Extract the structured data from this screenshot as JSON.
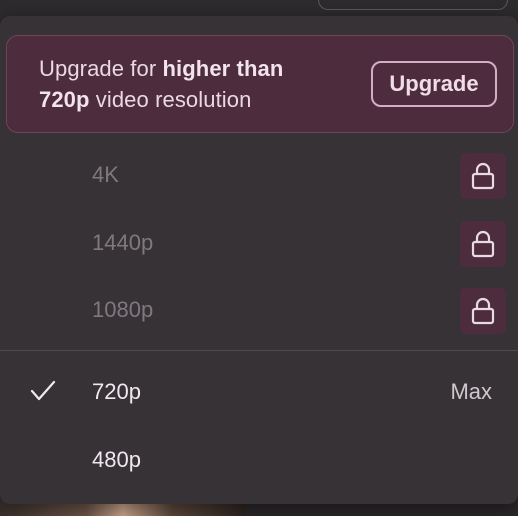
{
  "upgrade_banner": {
    "text_prefix": "Upgrade for ",
    "text_bold_1": "higher than",
    "text_bold_2": "720p",
    "text_suffix": " video resolution",
    "button_label": "Upgrade"
  },
  "resolutions": {
    "locked": [
      {
        "label": "4K",
        "icon": "lock-icon"
      },
      {
        "label": "1440p",
        "icon": "lock-icon"
      },
      {
        "label": "1080p",
        "icon": "lock-icon"
      }
    ],
    "available": [
      {
        "label": "720p",
        "selected": true,
        "badge": "Max",
        "icon": "checkmark-icon"
      },
      {
        "label": "480p",
        "selected": false
      }
    ]
  },
  "colors": {
    "accent_bg": "#4d2c3d",
    "menu_bg": "#363236",
    "locked_text": "#7f787e",
    "active_text": "#efe8ee"
  }
}
